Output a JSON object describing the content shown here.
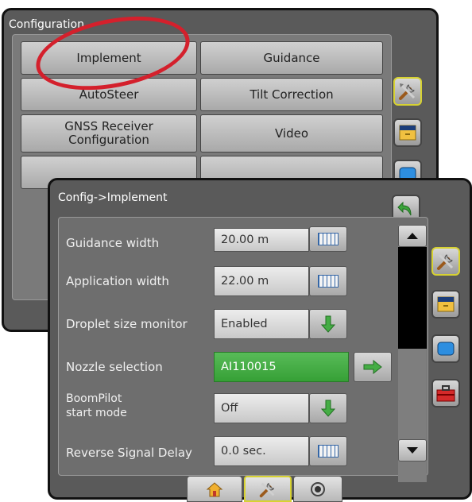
{
  "config_panel": {
    "title": "Configuration",
    "buttons": [
      "Implement",
      "Guidance",
      "AutoSteer",
      "Tilt Correction",
      "GNSS Receiver Configuration",
      "Video"
    ],
    "side_icons": [
      "tools-icon",
      "drawer-icon",
      "screen-icon"
    ]
  },
  "implement_panel": {
    "breadcrumb": "Config->Implement",
    "rows": [
      {
        "label": "Guidance width",
        "value": "20.00 m",
        "action": "keyboard-icon"
      },
      {
        "label": "Application width",
        "value": "22.00 m",
        "action": "keyboard-icon"
      },
      {
        "label": "Droplet size monitor",
        "value": "Enabled",
        "action": "down-arrow-icon"
      },
      {
        "label": "Nozzle selection",
        "value": "AI110015",
        "action": "right-arrow-icon"
      },
      {
        "label": "BoomPilot start mode",
        "value": "Off",
        "action": "down-arrow-icon"
      },
      {
        "label": "Reverse Signal Delay",
        "value": "0.0 sec.",
        "action": "keyboard-icon"
      }
    ],
    "side_icons": [
      "tools-icon",
      "drawer-icon",
      "screen-icon",
      "toolbox-icon"
    ],
    "bottom_tabs": [
      "home-icon",
      "tools-icon",
      "camera-icon"
    ],
    "accent_green": "#45ad45",
    "highlight_color": "#d4202c"
  }
}
